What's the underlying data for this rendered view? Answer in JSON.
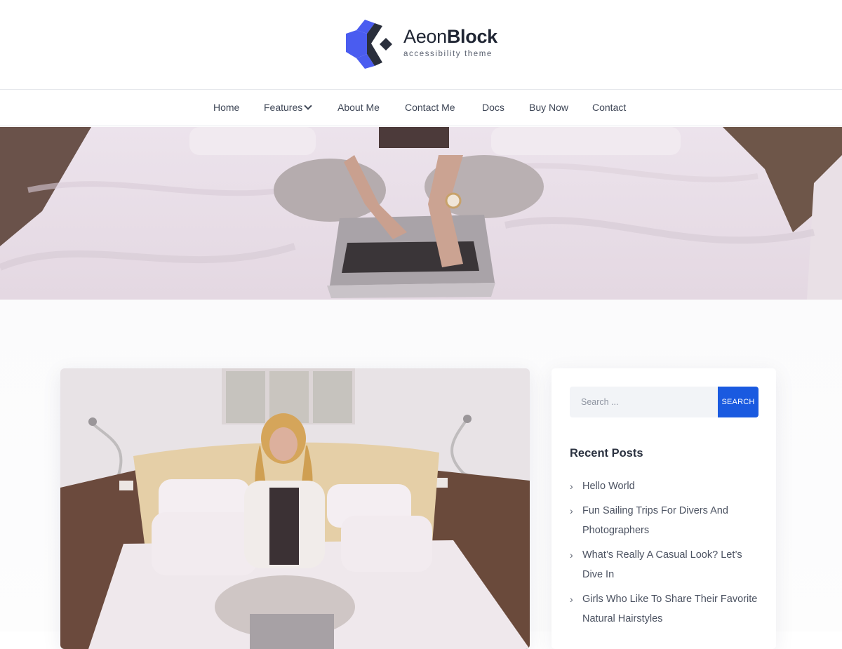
{
  "logo": {
    "brand_light": "Aeon",
    "brand_bold": "Block",
    "tagline": "accessibility theme",
    "colors": {
      "blue": "#4a5cf0",
      "dark": "#2a2f3c"
    }
  },
  "nav": {
    "items": [
      {
        "label": "Home"
      },
      {
        "label": "Features",
        "has_dropdown": true
      },
      {
        "label": "About Me"
      },
      {
        "label": "Contact Me"
      },
      {
        "label": "Docs"
      },
      {
        "label": "Buy Now"
      },
      {
        "label": "Contact"
      }
    ]
  },
  "hero": {
    "image": "woman-typing-on-laptop-on-bed-photo"
  },
  "post": {
    "featured_image": "woman-sitting-on-bed-with-laptop-photo"
  },
  "sidebar": {
    "search": {
      "placeholder": "Search ...",
      "button_label": "SEARCH"
    },
    "recent_posts": {
      "title": "Recent Posts",
      "items": [
        "Hello World",
        "Fun Sailing Trips For Divers And Photographers",
        "What’s Really A Casual Look? Let’s Dive In",
        "Girls Who Like To Share Their Favorite Natural Hairstyles"
      ]
    }
  },
  "colors": {
    "accent": "#1a5ae0",
    "text": "#3e4656"
  }
}
